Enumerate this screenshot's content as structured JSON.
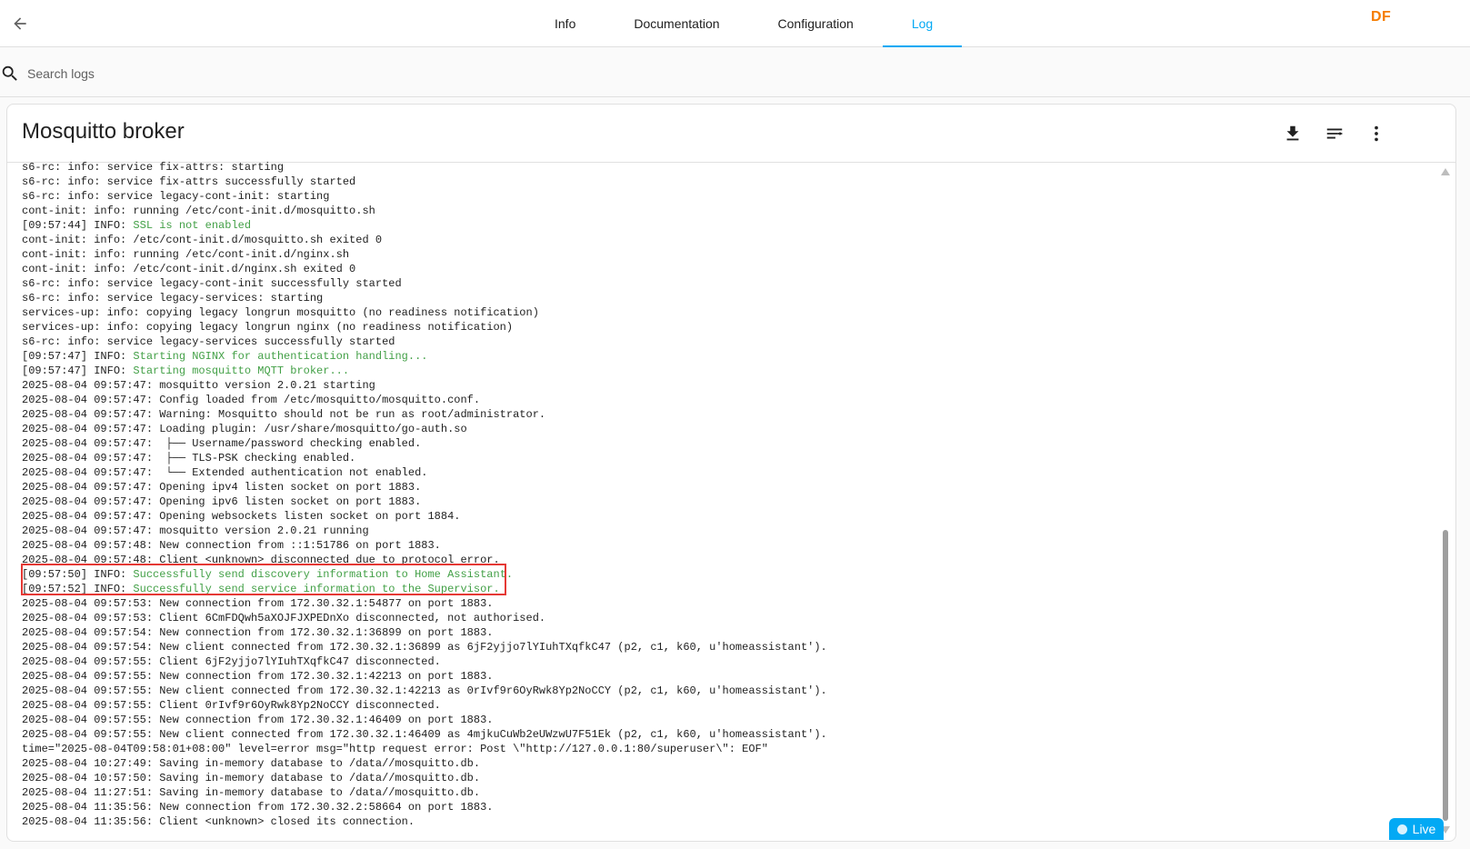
{
  "header": {
    "tabs": [
      {
        "label": "Info",
        "active": false
      },
      {
        "label": "Documentation",
        "active": false
      },
      {
        "label": "Configuration",
        "active": false
      },
      {
        "label": "Log",
        "active": true
      }
    ],
    "user_initials": "DF",
    "accent_color": "#03a9f4"
  },
  "search": {
    "placeholder": "Search logs",
    "value": ""
  },
  "card": {
    "title": "Mosquitto broker",
    "actions": [
      "download-icon",
      "wrap-lines-icon",
      "more-vertical-icon"
    ]
  },
  "log_lines": [
    {
      "prefix": "s6-rc: info: service fix-attrs: starting",
      "msg": ""
    },
    {
      "prefix": "s6-rc: info: service fix-attrs successfully started",
      "msg": ""
    },
    {
      "prefix": "s6-rc: info: service legacy-cont-init: starting",
      "msg": ""
    },
    {
      "prefix": "cont-init: info: running /etc/cont-init.d/mosquitto.sh",
      "msg": ""
    },
    {
      "prefix": "[09:57:44] INFO: ",
      "msg": "SSL is not enabled"
    },
    {
      "prefix": "cont-init: info: /etc/cont-init.d/mosquitto.sh exited 0",
      "msg": ""
    },
    {
      "prefix": "cont-init: info: running /etc/cont-init.d/nginx.sh",
      "msg": ""
    },
    {
      "prefix": "cont-init: info: /etc/cont-init.d/nginx.sh exited 0",
      "msg": ""
    },
    {
      "prefix": "s6-rc: info: service legacy-cont-init successfully started",
      "msg": ""
    },
    {
      "prefix": "s6-rc: info: service legacy-services: starting",
      "msg": ""
    },
    {
      "prefix": "services-up: info: copying legacy longrun mosquitto (no readiness notification)",
      "msg": ""
    },
    {
      "prefix": "services-up: info: copying legacy longrun nginx (no readiness notification)",
      "msg": ""
    },
    {
      "prefix": "s6-rc: info: service legacy-services successfully started",
      "msg": ""
    },
    {
      "prefix": "[09:57:47] INFO: ",
      "msg": "Starting NGINX for authentication handling..."
    },
    {
      "prefix": "[09:57:47] INFO: ",
      "msg": "Starting mosquitto MQTT broker..."
    },
    {
      "prefix": "2025-08-04 09:57:47: mosquitto version 2.0.21 starting",
      "msg": ""
    },
    {
      "prefix": "2025-08-04 09:57:47: Config loaded from /etc/mosquitto/mosquitto.conf.",
      "msg": ""
    },
    {
      "prefix": "2025-08-04 09:57:47: Warning: Mosquitto should not be run as root/administrator.",
      "msg": ""
    },
    {
      "prefix": "2025-08-04 09:57:47: Loading plugin: /usr/share/mosquitto/go-auth.so",
      "msg": ""
    },
    {
      "prefix": "2025-08-04 09:57:47:  ├── Username/password checking enabled.",
      "msg": ""
    },
    {
      "prefix": "2025-08-04 09:57:47:  ├── TLS-PSK checking enabled.",
      "msg": ""
    },
    {
      "prefix": "2025-08-04 09:57:47:  └── Extended authentication not enabled.",
      "msg": ""
    },
    {
      "prefix": "2025-08-04 09:57:47: Opening ipv4 listen socket on port 1883.",
      "msg": ""
    },
    {
      "prefix": "2025-08-04 09:57:47: Opening ipv6 listen socket on port 1883.",
      "msg": ""
    },
    {
      "prefix": "2025-08-04 09:57:47: Opening websockets listen socket on port 1884.",
      "msg": ""
    },
    {
      "prefix": "2025-08-04 09:57:47: mosquitto version 2.0.21 running",
      "msg": ""
    },
    {
      "prefix": "2025-08-04 09:57:48: New connection from ::1:51786 on port 1883.",
      "msg": ""
    },
    {
      "prefix": "2025-08-04 09:57:48: Client <unknown> disconnected due to protocol error.",
      "msg": ""
    },
    {
      "prefix": "[09:57:50] INFO: ",
      "msg": "Successfully send discovery information to Home Assistant."
    },
    {
      "prefix": "[09:57:52] INFO: ",
      "msg": "Successfully send service information to the Supervisor."
    },
    {
      "prefix": "2025-08-04 09:57:53: New connection from 172.30.32.1:54877 on port 1883.",
      "msg": ""
    },
    {
      "prefix": "2025-08-04 09:57:53: Client 6CmFDQwh5aXOJFJXPEDnXo disconnected, not authorised.",
      "msg": ""
    },
    {
      "prefix": "2025-08-04 09:57:54: New connection from 172.30.32.1:36899 on port 1883.",
      "msg": ""
    },
    {
      "prefix": "2025-08-04 09:57:54: New client connected from 172.30.32.1:36899 as 6jF2yjjo7lYIuhTXqfkC47 (p2, c1, k60, u'homeassistant').",
      "msg": ""
    },
    {
      "prefix": "2025-08-04 09:57:55: Client 6jF2yjjo7lYIuhTXqfkC47 disconnected.",
      "msg": ""
    },
    {
      "prefix": "2025-08-04 09:57:55: New connection from 172.30.32.1:42213 on port 1883.",
      "msg": ""
    },
    {
      "prefix": "2025-08-04 09:57:55: New client connected from 172.30.32.1:42213 as 0rIvf9r6OyRwk8Yp2NoCCY (p2, c1, k60, u'homeassistant').",
      "msg": ""
    },
    {
      "prefix": "2025-08-04 09:57:55: Client 0rIvf9r6OyRwk8Yp2NoCCY disconnected.",
      "msg": ""
    },
    {
      "prefix": "2025-08-04 09:57:55: New connection from 172.30.32.1:46409 on port 1883.",
      "msg": ""
    },
    {
      "prefix": "2025-08-04 09:57:55: New client connected from 172.30.32.1:46409 as 4mjkuCuWb2eUWzwU7F51Ek (p2, c1, k60, u'homeassistant').",
      "msg": ""
    },
    {
      "prefix": "time=\"2025-08-04T09:58:01+08:00\" level=error msg=\"http request error: Post \\\"http://127.0.0.1:80/superuser\\\": EOF\"",
      "msg": ""
    },
    {
      "prefix": "2025-08-04 10:27:49: Saving in-memory database to /data//mosquitto.db.",
      "msg": ""
    },
    {
      "prefix": "2025-08-04 10:57:50: Saving in-memory database to /data//mosquitto.db.",
      "msg": ""
    },
    {
      "prefix": "2025-08-04 11:27:51: Saving in-memory database to /data//mosquitto.db.",
      "msg": ""
    },
    {
      "prefix": "2025-08-04 11:35:56: New connection from 172.30.32.2:58664 on port 1883.",
      "msg": ""
    },
    {
      "prefix": "2025-08-04 11:35:56: Client <unknown> closed its connection.",
      "msg": ""
    }
  ],
  "live": {
    "label": "Live"
  }
}
